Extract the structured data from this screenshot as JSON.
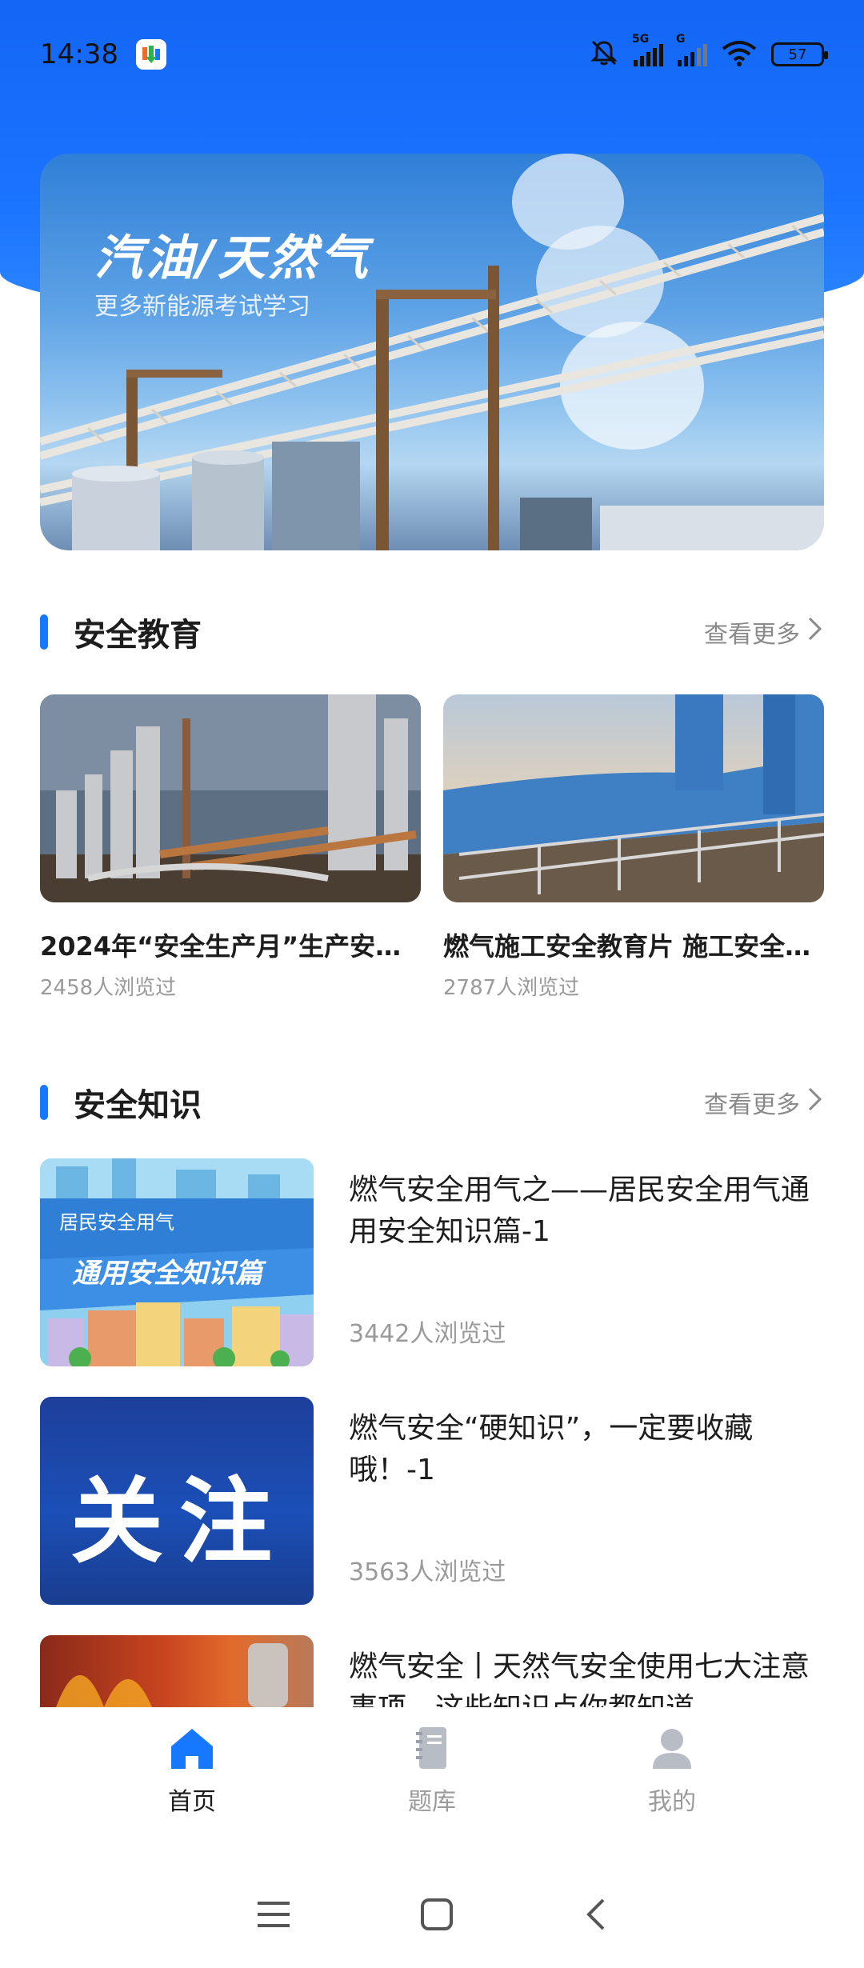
{
  "status_bar": {
    "time": "14:38",
    "net1": "5G",
    "net2": "G",
    "battery": "57"
  },
  "banner": {
    "title": "汽油/天然气",
    "subtitle": "更多新能源考试学习"
  },
  "section_safety_education": {
    "title": "安全教育",
    "more": "查看更多"
  },
  "videos": [
    {
      "title": "2024年“安全生产月”生产安全…",
      "views": "2458人浏览过"
    },
    {
      "title": "燃气施工安全教育片 施工安全…",
      "views": "2787人浏览过"
    }
  ],
  "section_safety_knowledge": {
    "title": "安全知识",
    "more": "查看更多"
  },
  "articles": [
    {
      "title": "燃气安全用气之——居民安全用气通用安全知识篇-1",
      "views": "3442人浏览过",
      "thumb_text_1": "居民安全用气",
      "thumb_text_2": "通用安全知识篇"
    },
    {
      "title": "燃气安全“硬知识”，一定要收藏哦！-1",
      "views": "3563人浏览过",
      "thumb_text_1": "关注"
    },
    {
      "title": "燃气安全丨天然气安全使用七大注意事项，这些知识点你都知道",
      "views": ""
    }
  ],
  "bottom_nav": [
    {
      "label": "首页",
      "icon": "home-icon",
      "active": true
    },
    {
      "label": "题库",
      "icon": "question-bank-icon",
      "active": false
    },
    {
      "label": "我的",
      "icon": "profile-icon",
      "active": false
    }
  ],
  "colors": {
    "primary": "#1677ff",
    "header_blue": "#1a73ff",
    "muted_text": "#9a9a9a"
  }
}
